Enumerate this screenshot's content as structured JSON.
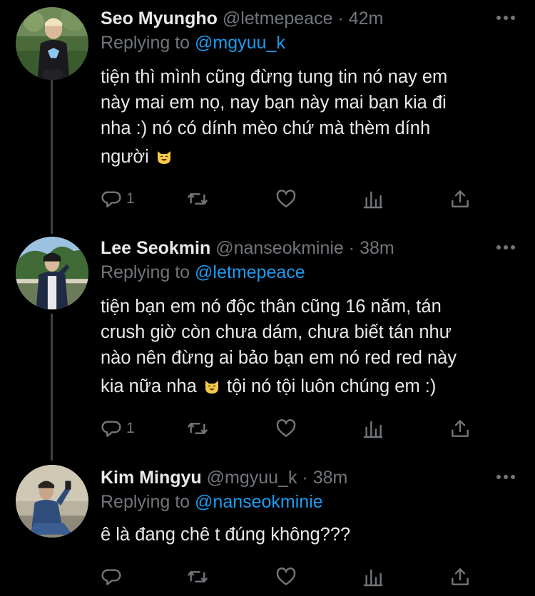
{
  "tweets": [
    {
      "name": "Seo Myungho",
      "handle": "@letmepeace",
      "time": "42m",
      "reply_prefix": "Replying to",
      "reply_to": "@mgyuu_k",
      "lines": [
        "tiện thì mình cũng đừng tung tin nó nay em",
        "này mai em nọ, nay bạn này mai bạn kia đi",
        "nha :) nó có dính mèo chứ mà thèm dính",
        "người"
      ],
      "emoji_after_line": 3,
      "emoji": "smiling-cat-emoji",
      "reply_count": "1",
      "retweet_count": "",
      "like_count": ""
    },
    {
      "name": "Lee Seokmin",
      "handle": "@nanseokminie",
      "time": "38m",
      "reply_prefix": "Replying to",
      "reply_to": "@letmepeace",
      "lines": [
        "tiện bạn em nó độc thân cũng 16 năm, tán",
        "crush giờ còn chưa dám, chưa biết tán như",
        "nào nên đừng ai bảo bạn em nó red red này",
        "kia nữa nha",
        "tội nó tội luôn chúng em :)"
      ],
      "emoji": "smiling-cat-emoji",
      "reply_count": "1",
      "retweet_count": "",
      "like_count": ""
    },
    {
      "name": "Kim Mingyu",
      "handle": "@mgyuu_k",
      "time": "38m",
      "reply_prefix": "Replying to",
      "reply_to": "@nanseokminie",
      "lines": [
        "ê là đang chê t đúng không???"
      ],
      "reply_count": "",
      "retweet_count": "",
      "like_count": ""
    }
  ],
  "separator": "·",
  "colors": {
    "background": "#000000",
    "text": "#e7e9ea",
    "muted": "#71767b",
    "link": "#1d9bf0",
    "thread_line": "#3d4146"
  },
  "icons": [
    "reply-icon",
    "retweet-icon",
    "like-icon",
    "analytics-icon",
    "share-icon",
    "more-icon"
  ]
}
